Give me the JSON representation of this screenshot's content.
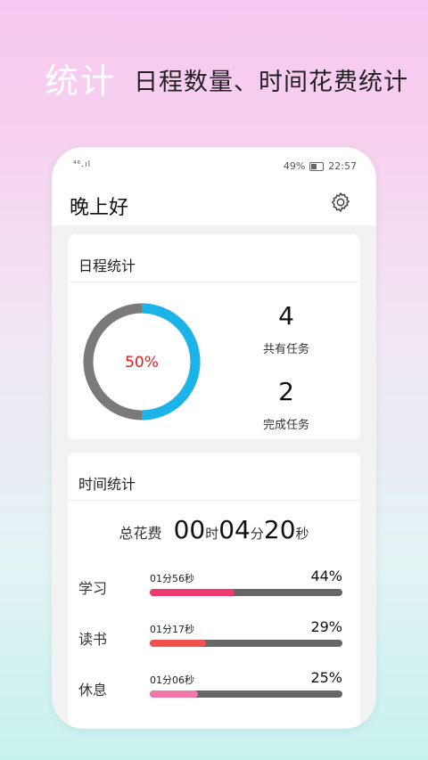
{
  "hero": {
    "title": "统计",
    "subtitle": "日程数量、时间花费统计"
  },
  "status_bar": {
    "signal_text": "⁴⁶.ıl",
    "battery": "49%",
    "time": "22:57"
  },
  "header": {
    "greeting": "晚上好",
    "settings_icon": "gear-icon"
  },
  "schedule_stats": {
    "title": "日程统计",
    "completion_percent_label": "50%",
    "completion_fraction": 0.5,
    "ring_colors": {
      "done": "#1ab4e8",
      "remaining": "#7a7a7a"
    },
    "total_count": "4",
    "total_label": "共有任务",
    "done_count": "2",
    "done_label": "完成任务"
  },
  "time_stats": {
    "title": "时间统计",
    "total_label": "总花费",
    "hours": "00",
    "hours_unit": "时",
    "minutes": "04",
    "minutes_unit": "分",
    "seconds": "20",
    "seconds_unit": "秒",
    "items": [
      {
        "name": "学习",
        "duration": "01分56秒",
        "percent": "44%",
        "fraction": 0.44,
        "color": "#ee3a6c"
      },
      {
        "name": "读书",
        "duration": "01分17秒",
        "percent": "29%",
        "fraction": 0.29,
        "color": "#f05252"
      },
      {
        "name": "休息",
        "duration": "01分06秒",
        "percent": "25%",
        "fraction": 0.25,
        "color": "#f276a6"
      }
    ]
  }
}
